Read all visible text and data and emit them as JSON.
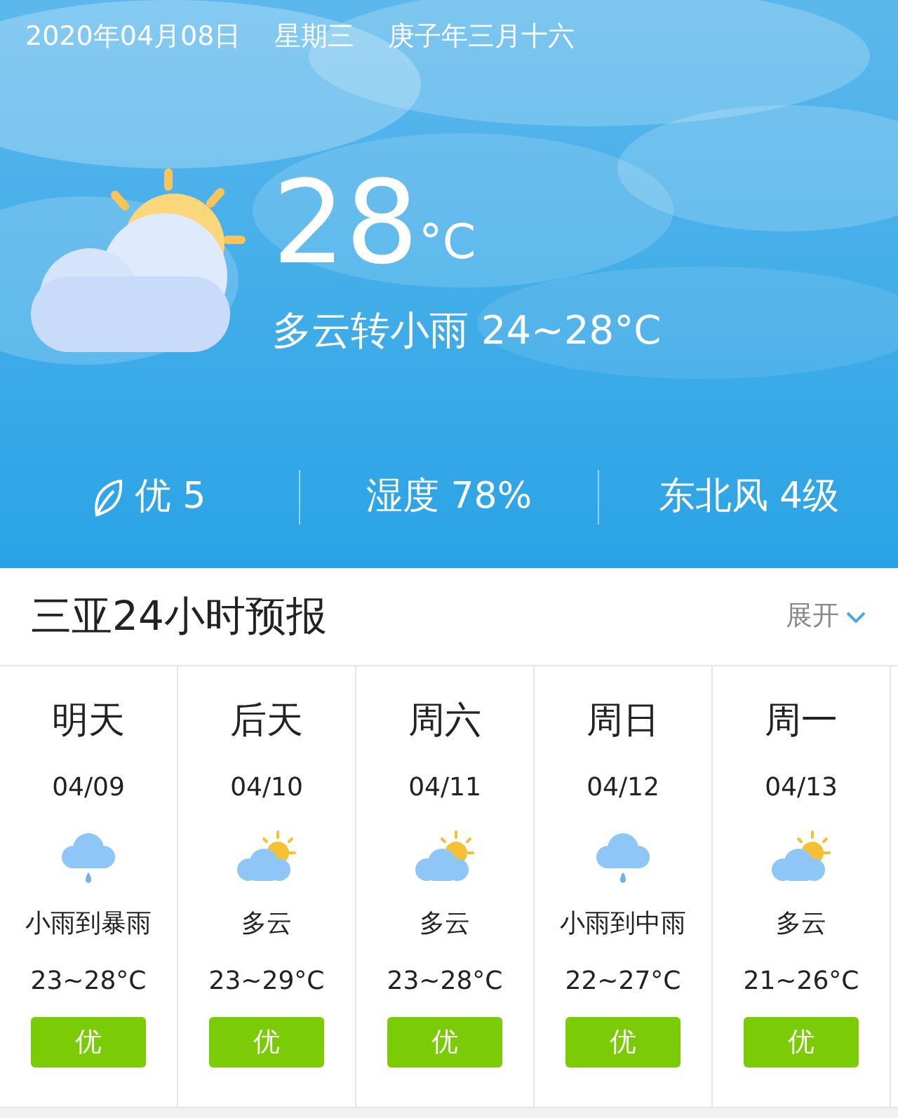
{
  "header": {
    "date": "2020年04月08日",
    "weekday": "星期三",
    "lunar": "庚子年三月十六"
  },
  "current": {
    "temperature": "28",
    "unit": "°C",
    "summary": "多云转小雨 24~28°C"
  },
  "stats": [
    {
      "kind": "aqi",
      "text": "优 5"
    },
    {
      "kind": "plain",
      "text": "湿度 78%"
    },
    {
      "kind": "plain",
      "text": "东北风 4级"
    }
  ],
  "forecast_section": {
    "title": "三亚24小时预报",
    "expand": "展开"
  },
  "days": [
    {
      "day": "明天",
      "date": "04/09",
      "kind": "rain",
      "desc": "小雨到暴雨",
      "range": "23~28°C",
      "aqi": "优"
    },
    {
      "day": "后天",
      "date": "04/10",
      "kind": "partly_cloudy",
      "desc": "多云",
      "range": "23~29°C",
      "aqi": "优"
    },
    {
      "day": "周六",
      "date": "04/11",
      "kind": "partly_cloudy",
      "desc": "多云",
      "range": "23~28°C",
      "aqi": "优"
    },
    {
      "day": "周日",
      "date": "04/12",
      "kind": "rain",
      "desc": "小雨到中雨",
      "range": "22~27°C",
      "aqi": "优"
    },
    {
      "day": "周一",
      "date": "04/13",
      "kind": "partly_cloudy",
      "desc": "多云",
      "range": "21~26°C",
      "aqi": "优"
    }
  ]
}
